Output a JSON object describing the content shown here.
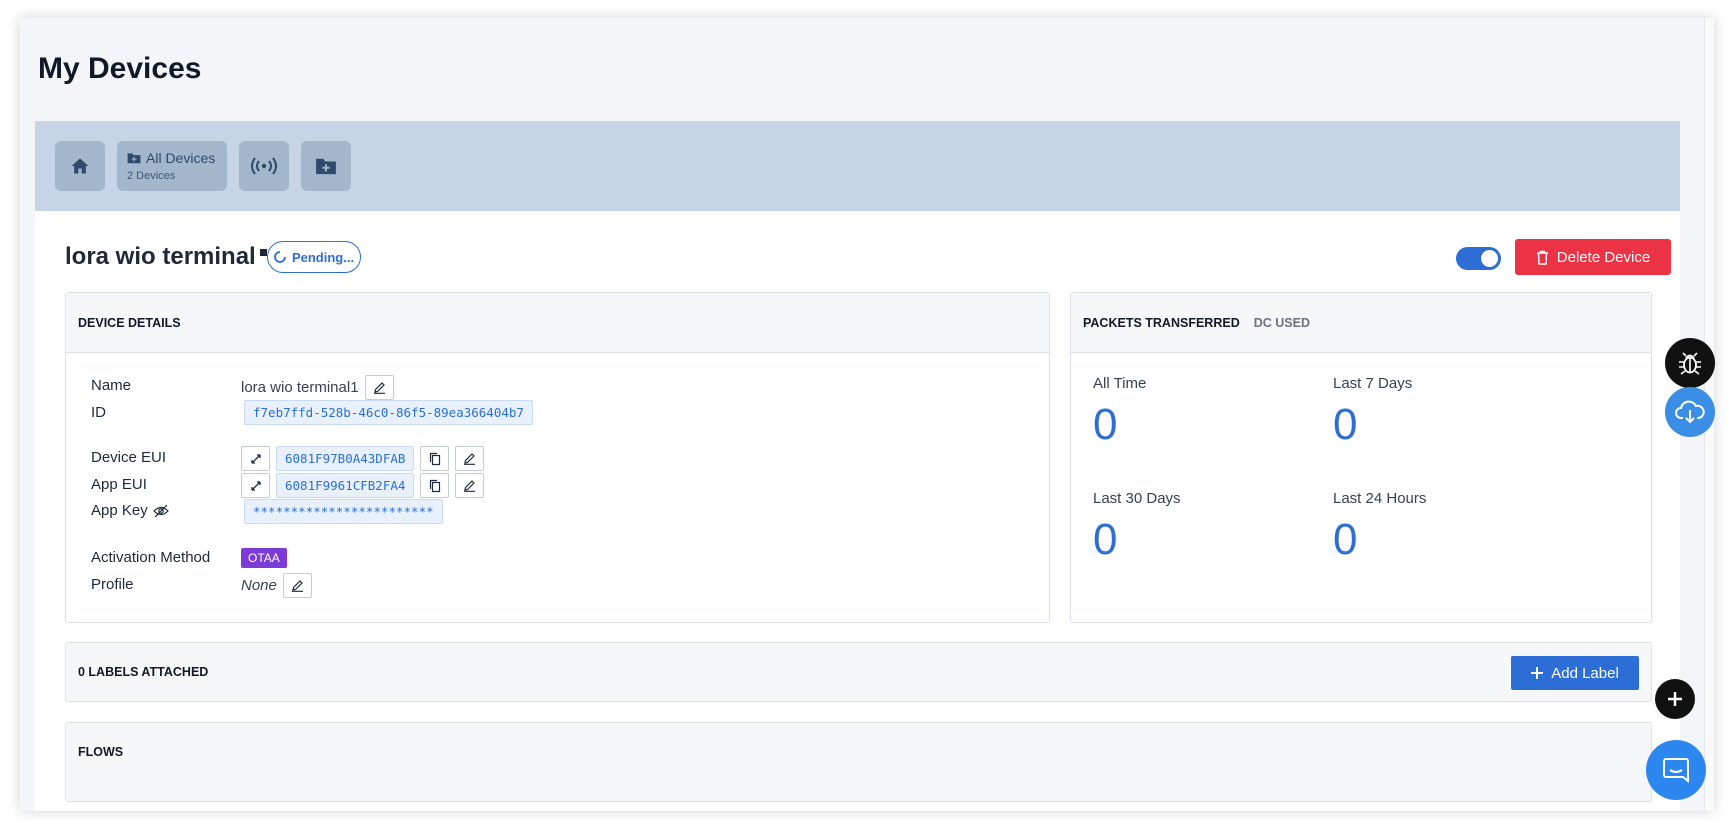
{
  "page": {
    "title": "My Devices"
  },
  "toolbar": {
    "all_devices_label": "All Devices",
    "all_devices_count": "2 Devices"
  },
  "device": {
    "title": "lora wio terminal",
    "status": "Pending...",
    "enabled": true,
    "delete_label": "Delete Device"
  },
  "details": {
    "header": "DEVICE DETAILS",
    "name_label": "Name",
    "name_value": "lora wio terminal1",
    "id_label": "ID",
    "id_value": "f7eb7ffd-528b-46c0-86f5-89ea366404b7",
    "device_eui_label": "Device EUI",
    "device_eui_value": "6081F97B0A43DFAB",
    "app_eui_label": "App EUI",
    "app_eui_value": "6081F9961CFB2FA4",
    "app_key_label": "App Key",
    "app_key_value": "************************",
    "activation_label": "Activation Method",
    "activation_value": "OTAA",
    "profile_label": "Profile",
    "profile_value": "None"
  },
  "stats": {
    "tab_packets": "PACKETS TRANSFERRED",
    "tab_dc": "DC USED",
    "all_time_label": "All Time",
    "all_time_value": "0",
    "last7_label": "Last 7 Days",
    "last7_value": "0",
    "last30_label": "Last 30 Days",
    "last30_value": "0",
    "last24_label": "Last 24 Hours",
    "last24_value": "0"
  },
  "labels": {
    "header": "0 LABELS ATTACHED",
    "add_label": "Add Label"
  },
  "flows": {
    "header": "FLOWS"
  },
  "colors": {
    "accent": "#2c6ed6",
    "danger": "#ec3345",
    "otaa": "#7c3bd6",
    "toolbar_bg": "#c6d5e5"
  }
}
